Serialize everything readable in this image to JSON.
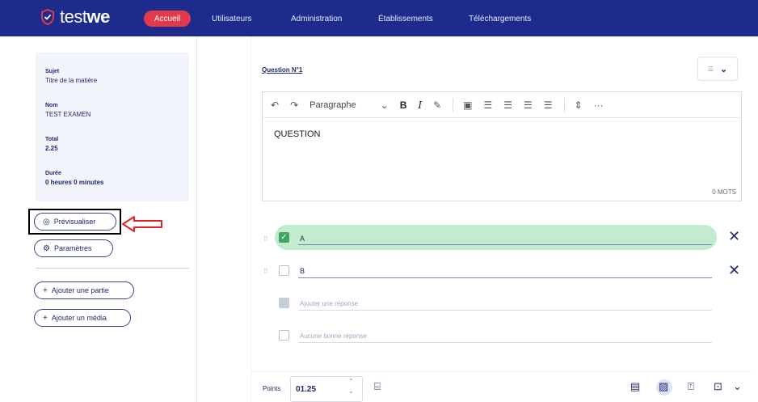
{
  "brand": {
    "name_light": "test",
    "name_bold": "we"
  },
  "nav": {
    "items": [
      {
        "label": "Accueil"
      },
      {
        "label": "Utilisateurs"
      },
      {
        "label": "Administration"
      },
      {
        "label": "Établissements"
      },
      {
        "label": "Téléchargements"
      }
    ]
  },
  "sidebar": {
    "info": [
      {
        "label": "Sujet",
        "value": "Titre de la matière"
      },
      {
        "label": "Nom",
        "value": "TEST EXAMEN"
      },
      {
        "label": "Total",
        "value": "2.25"
      },
      {
        "label": "Durée",
        "value": "0 heures 0 minutes"
      }
    ],
    "buttons": {
      "preview": "Prévisualiser",
      "settings": "Paramètres",
      "add_part": "Ajouter une partie",
      "add_media": "Ajouter un média"
    }
  },
  "question": {
    "title": "Question N°1",
    "toolbar": {
      "paragraph": "Paragraphe",
      "bold": "B",
      "italic": "I",
      "more": "···"
    },
    "content": "QUESTION",
    "wordcount": "0 MOTS",
    "answers": [
      {
        "text": "A",
        "checked": true
      },
      {
        "text": "B",
        "checked": false
      }
    ],
    "add_answer_placeholder": "Ajouter une réponse",
    "no_correct_label": "Aucune bonne réponse",
    "points_label": "Points",
    "points_value": "01.25"
  },
  "colors": {
    "nav_bg": "#1c2b8c",
    "accent_red": "#e23a4d",
    "correct_green": "#c2eccd",
    "check_green": "#3ea661"
  }
}
